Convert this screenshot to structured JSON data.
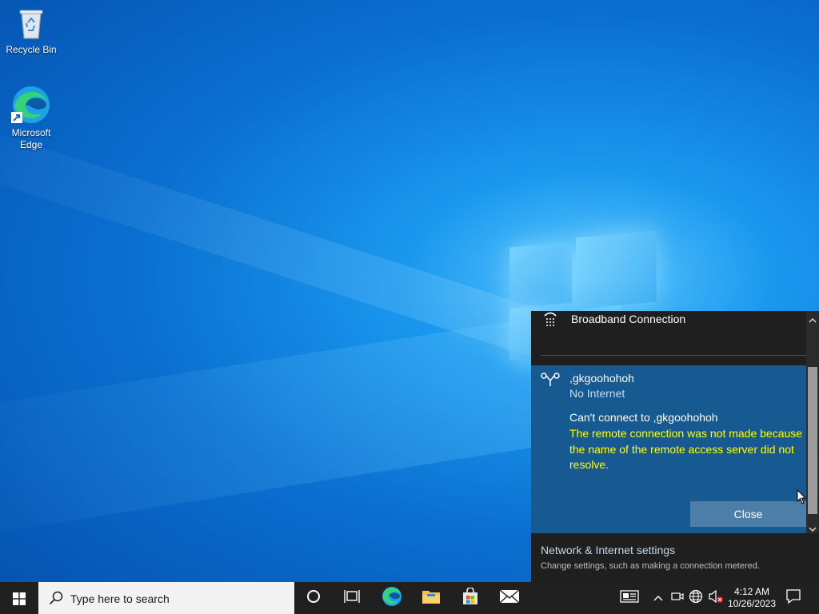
{
  "desktop": {
    "icons": [
      {
        "label": "Recycle Bin"
      },
      {
        "label": "Microsoft Edge"
      }
    ]
  },
  "flyout": {
    "broadband": {
      "name": "Broadband Connection"
    },
    "connection": {
      "name": ",gkgoohohoh",
      "status": "No Internet",
      "error_title": "Can't connect to ,gkgoohohoh",
      "error_message": "The remote connection was not made because the name of the remote access server did not resolve.",
      "close_label": "Close"
    },
    "settings": {
      "title": "Network & Internet settings",
      "subtitle": "Change settings, such as making a connection metered."
    }
  },
  "taskbar": {
    "search_placeholder": "Type here to search",
    "clock": {
      "time": "4:12 AM",
      "date": "10/26/2023"
    }
  },
  "colors": {
    "error_text": "#ffff00",
    "card_bg": "#175a92",
    "flyout_bg": "#1f1f1f",
    "taskbar_bg": "#202020"
  }
}
